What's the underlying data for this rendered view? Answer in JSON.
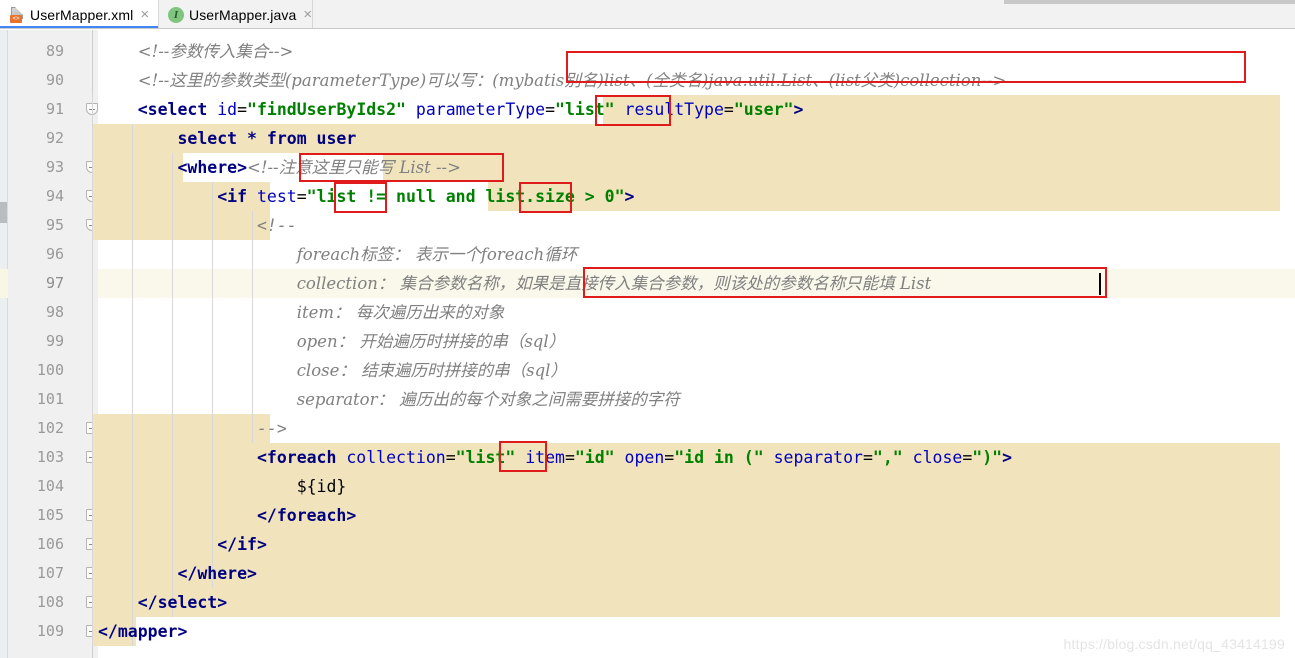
{
  "window": {
    "app": "IntelliJ IDEA XML Editor",
    "watermark": "https://blog.csdn.net/qq_43414199"
  },
  "tabs": [
    {
      "label": "UserMapper.xml",
      "icon": "xml-file-icon",
      "icon_badge": "<>",
      "close": "×",
      "active": true
    },
    {
      "label": "UserMapper.java",
      "icon": "java-interface-icon",
      "icon_letter": "I",
      "close": "×",
      "active": false
    }
  ],
  "gutter": {
    "line_numbers": [
      "89",
      "90",
      "91",
      "92",
      "93",
      "94",
      "95",
      "96",
      "97",
      "98",
      "99",
      "100",
      "101",
      "102",
      "103",
      "104",
      "105",
      "106",
      "107",
      "108",
      "109"
    ],
    "current_line": "97",
    "fold_lines": [
      "91",
      "93",
      "94",
      "95",
      "102",
      "103",
      "105",
      "106",
      "107",
      "108",
      "109"
    ]
  },
  "code": {
    "lines": [
      {
        "num": "89",
        "indent": "    ",
        "segments": [
          {
            "t": "cmtcn",
            "v": "<!--参数传入集合-->"
          }
        ]
      },
      {
        "num": "90",
        "indent": "    ",
        "segments": [
          {
            "t": "cmtcn",
            "v": "<!--这里的参数类型(parameterType)可以写：(mybatis别名)list、(全类名)java.util.List、(list父类)collection-->"
          }
        ]
      },
      {
        "num": "91",
        "indent": "    ",
        "segments": [
          {
            "t": "tag",
            "v": "<select"
          },
          {
            "t": "attr",
            "v": " id"
          },
          {
            "t": "punc",
            "v": "="
          },
          {
            "t": "str",
            "v": "\"findUserByIds2\""
          },
          {
            "t": "attr",
            "v": " parameterType"
          },
          {
            "t": "punc",
            "v": "="
          },
          {
            "t": "str",
            "v": "\"list\""
          },
          {
            "t": "attr",
            "v": " resultType"
          },
          {
            "t": "punc",
            "v": "="
          },
          {
            "t": "str",
            "v": "\"user\""
          },
          {
            "t": "tag",
            "v": ">"
          }
        ]
      },
      {
        "num": "92",
        "indent": "        ",
        "segments": [
          {
            "t": "sql",
            "v": "select * from user"
          }
        ]
      },
      {
        "num": "93",
        "indent": "        ",
        "segments": [
          {
            "t": "tag",
            "v": "<where>"
          },
          {
            "t": "cmtcn",
            "v": "<!--注意这里只能写 List -->"
          }
        ]
      },
      {
        "num": "94",
        "indent": "            ",
        "segments": [
          {
            "t": "tag",
            "v": "<if"
          },
          {
            "t": "attr",
            "v": " test"
          },
          {
            "t": "punc",
            "v": "="
          },
          {
            "t": "str",
            "v": "\"list != null and list.size > 0\""
          },
          {
            "t": "tag",
            "v": ">"
          }
        ]
      },
      {
        "num": "95",
        "indent": "                ",
        "segments": [
          {
            "t": "cmt",
            "v": "<!--"
          }
        ]
      },
      {
        "num": "96",
        "indent": "                    ",
        "segments": [
          {
            "t": "cmtcn",
            "v": "foreach标签： 表示一个foreach循环"
          }
        ]
      },
      {
        "num": "97",
        "indent": "                    ",
        "segments": [
          {
            "t": "cmtcn",
            "v": "collection： 集合参数名称，如果是直接传入集合参数，则该处的参数名称只能填 List"
          }
        ]
      },
      {
        "num": "98",
        "indent": "                    ",
        "segments": [
          {
            "t": "cmtcn",
            "v": "item： 每次遍历出来的对象"
          }
        ]
      },
      {
        "num": "99",
        "indent": "                    ",
        "segments": [
          {
            "t": "cmtcn",
            "v": "open： 开始遍历时拼接的串（sql）"
          }
        ]
      },
      {
        "num": "100",
        "indent": "                    ",
        "segments": [
          {
            "t": "cmtcn",
            "v": "close： 结束遍历时拼接的串（sql）"
          }
        ]
      },
      {
        "num": "101",
        "indent": "                    ",
        "segments": [
          {
            "t": "cmtcn",
            "v": "separator： 遍历出的每个对象之间需要拼接的字符"
          }
        ]
      },
      {
        "num": "102",
        "indent": "                ",
        "segments": [
          {
            "t": "cmt",
            "v": "-->"
          }
        ]
      },
      {
        "num": "103",
        "indent": "                ",
        "segments": [
          {
            "t": "tag",
            "v": "<foreach"
          },
          {
            "t": "attr",
            "v": " collection"
          },
          {
            "t": "punc",
            "v": "="
          },
          {
            "t": "str",
            "v": "\"list\""
          },
          {
            "t": "attr",
            "v": " item"
          },
          {
            "t": "punc",
            "v": "="
          },
          {
            "t": "str",
            "v": "\"id\""
          },
          {
            "t": "attr",
            "v": " open"
          },
          {
            "t": "punc",
            "v": "="
          },
          {
            "t": "str",
            "v": "\"id in (\""
          },
          {
            "t": "attr",
            "v": " separator"
          },
          {
            "t": "punc",
            "v": "="
          },
          {
            "t": "str",
            "v": "\",\""
          },
          {
            "t": "attr",
            "v": " close"
          },
          {
            "t": "punc",
            "v": "="
          },
          {
            "t": "str",
            "v": "\")\""
          },
          {
            "t": "tag",
            "v": ">"
          }
        ]
      },
      {
        "num": "104",
        "indent": "                    ",
        "segments": [
          {
            "t": "elv",
            "v": "${id}"
          }
        ]
      },
      {
        "num": "105",
        "indent": "                ",
        "segments": [
          {
            "t": "tag",
            "v": "</foreach>"
          }
        ]
      },
      {
        "num": "106",
        "indent": "            ",
        "segments": [
          {
            "t": "tag",
            "v": "</if>"
          }
        ]
      },
      {
        "num": "107",
        "indent": "        ",
        "segments": [
          {
            "t": "tag",
            "v": "</where>"
          }
        ]
      },
      {
        "num": "108",
        "indent": "    ",
        "segments": [
          {
            "t": "tag",
            "v": "</select>"
          }
        ]
      },
      {
        "num": "109",
        "indent": "",
        "segments": [
          {
            "t": "tag",
            "v": "</mapper>"
          }
        ]
      }
    ]
  },
  "annotations": {
    "highlight_color": "#f1e4bd",
    "current_line_color": "#faf8ea",
    "box_color": "#e01b1b",
    "boxes": [
      {
        "label": "box-line90-types",
        "note": "(mybatis别名)list、(全类名)java.util.List、(list父类)collection"
      },
      {
        "label": "box-line91-list",
        "note": "\"list\""
      },
      {
        "label": "box-line93-note",
        "note": "注意这里只能写 List"
      },
      {
        "label": "box-line94-list-a",
        "note": "list"
      },
      {
        "label": "box-line94-list-b",
        "note": "list"
      },
      {
        "label": "box-line97-note",
        "note": "如果是直接传入集合参数，则该处的参数名称只能填 List"
      },
      {
        "label": "box-line103-list",
        "note": "list"
      }
    ]
  }
}
